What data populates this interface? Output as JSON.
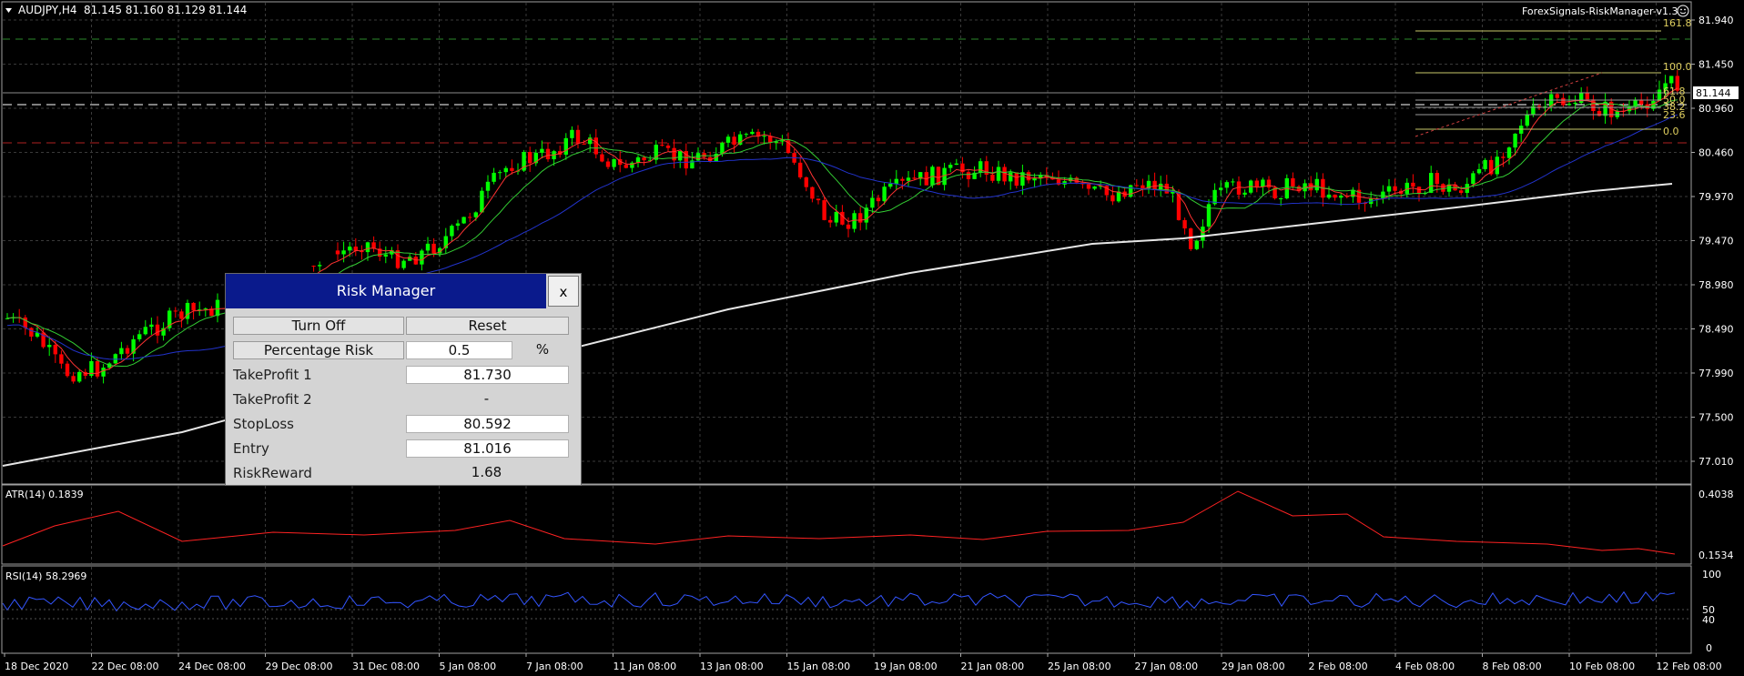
{
  "header": {
    "symbol": "AUDJPY,H4",
    "ohlc": "81.145 81.160 81.129 81.144",
    "expert": "ForexSignals-RiskManager-v1.3"
  },
  "price_axis": [
    "81.940",
    "81.450",
    "80.960",
    "80.460",
    "79.970",
    "79.470",
    "78.980",
    "78.490",
    "77.990",
    "77.500",
    "77.010"
  ],
  "current_price": "81.144",
  "fib_levels": [
    "161.8",
    "100.0",
    "61.8",
    "50.0",
    "38.2",
    "23.6",
    "0.0"
  ],
  "time_axis": [
    "18 Dec 2020",
    "22 Dec 08:00",
    "24 Dec 08:00",
    "29 Dec 08:00",
    "31 Dec 08:00",
    "5 Jan 08:00",
    "7 Jan 08:00",
    "11 Jan 08:00",
    "13 Jan 08:00",
    "15 Jan 08:00",
    "19 Jan 08:00",
    "21 Jan 08:00",
    "25 Jan 08:00",
    "27 Jan 08:00",
    "29 Jan 08:00",
    "2 Feb 08:00",
    "4 Feb 08:00",
    "8 Feb 08:00",
    "10 Feb 08:00",
    "12 Feb 08:00"
  ],
  "atr": {
    "label": "ATR(14) 0.1839",
    "top": "0.4038",
    "bottom": "0.1534"
  },
  "rsi": {
    "label": "RSI(14) 58.2969",
    "levels": [
      "100",
      "50",
      "40",
      "0"
    ]
  },
  "risk_manager": {
    "title": "Risk Manager",
    "close_label": "x",
    "turn_off": "Turn Off",
    "reset": "Reset",
    "percentage_risk_label": "Percentage Risk",
    "percentage_risk_value": "0.5",
    "percent_sign": "%",
    "tp1_label": "TakeProfit 1",
    "tp1_value": "81.730",
    "tp2_label": "TakeProfit 2",
    "tp2_value": "-",
    "sl_label": "StopLoss",
    "sl_value": "80.592",
    "entry_label": "Entry",
    "entry_value": "81.016",
    "rr_label": "RiskReward",
    "rr_value": "1.68"
  },
  "colors": {
    "bull": "#00ff00",
    "bear": "#ff0000",
    "grid": "#3a3a3a",
    "ma_fast": "#ff3333",
    "ma_mid": "#33cc33",
    "ma_slow": "#2233cc",
    "ma_long": "#e6e6e6",
    "atr": "#ff2222",
    "rsi": "#3355ff",
    "panel_title": "#0a1a8c"
  }
}
